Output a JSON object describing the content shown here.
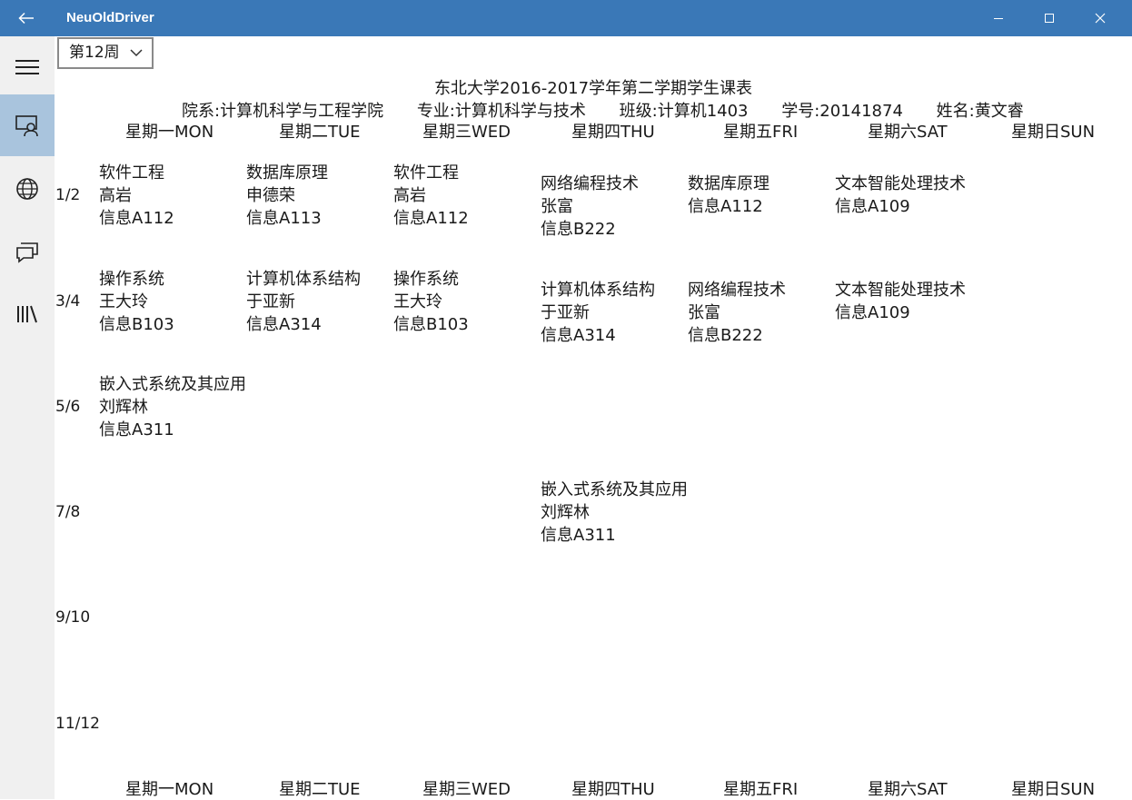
{
  "app": {
    "title": "NeuOldDriver"
  },
  "nav": [
    "menu-icon",
    "user-profile-icon",
    "globe-icon",
    "chat-icon",
    "library-icon"
  ],
  "week_selector": {
    "value": "第12周"
  },
  "schedule": {
    "title": "东北大学2016-2017学年第二学期学生课表",
    "info": {
      "dept": "院系:计算机科学与工程学院",
      "major": "专业:计算机科学与技术",
      "class": "班级:计算机1403",
      "student_id": "学号:20141874",
      "name": "姓名:黄文睿"
    },
    "days": [
      "星期一MON",
      "星期二TUE",
      "星期三WED",
      "星期四THU",
      "星期五FRI",
      "星期六SAT",
      "星期日SUN"
    ],
    "periods": [
      "1/2",
      "3/4",
      "5/6",
      "7/8",
      "9/10",
      "11/12"
    ],
    "rows": [
      [
        {
          "name": "软件工程",
          "teacher": "高岩",
          "room": "信息A112"
        },
        {
          "name": "数据库原理",
          "teacher": "申德荣",
          "room": "信息A113"
        },
        {
          "name": "软件工程",
          "teacher": "高岩",
          "room": "信息A112"
        },
        {
          "name": "网络编程技术",
          "teacher": "张富",
          "room": "信息B222"
        },
        {
          "name": "数据库原理",
          "teacher": "",
          "room": "信息A112"
        },
        {
          "name": "文本智能处理技术",
          "teacher": "",
          "room": "信息A109"
        },
        null
      ],
      [
        {
          "name": "操作系统",
          "teacher": "王大玲",
          "room": "信息B103"
        },
        {
          "name": "计算机体系结构",
          "teacher": "于亚新",
          "room": "信息A314"
        },
        {
          "name": "操作系统",
          "teacher": "王大玲",
          "room": "信息B103"
        },
        {
          "name": "计算机体系结构",
          "teacher": "于亚新",
          "room": "信息A314"
        },
        {
          "name": "网络编程技术",
          "teacher": "张富",
          "room": "信息B222"
        },
        {
          "name": "文本智能处理技术",
          "teacher": "",
          "room": "信息A109"
        },
        null
      ],
      [
        {
          "name": "嵌入式系统及其应用",
          "teacher": "刘辉林",
          "room": "信息A311"
        },
        null,
        null,
        null,
        null,
        null,
        null
      ],
      [
        null,
        null,
        null,
        {
          "name": "嵌入式系统及其应用",
          "teacher": "刘辉林",
          "room": "信息A311"
        },
        null,
        null,
        null
      ],
      [
        null,
        null,
        null,
        null,
        null,
        null,
        null
      ],
      [
        null,
        null,
        null,
        null,
        null,
        null,
        null
      ]
    ]
  }
}
